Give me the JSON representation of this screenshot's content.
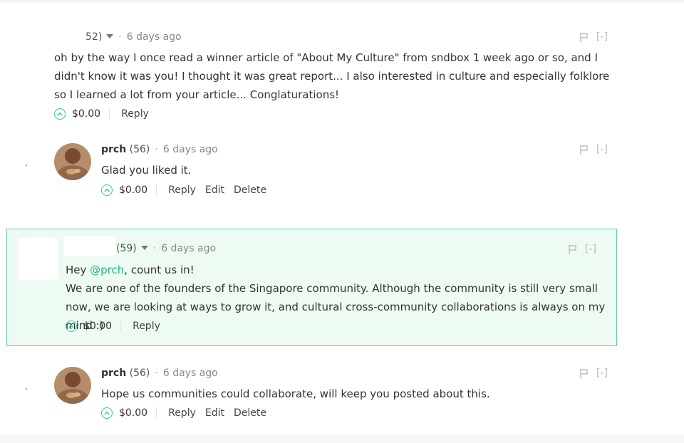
{
  "comments": [
    {
      "author": "",
      "reputation": "52)",
      "time": "6 days ago",
      "text": "oh by the way I once read a winner article of \"About My Culture\" from sndbox 1 week ago or so, and I didn't know it was you! I thought it was great report... I also interested in culture and especially folklore so I learned a lot from your article... Conglaturations!",
      "payout": "$0.00",
      "actions": {
        "reply": "Reply"
      },
      "collapse": "[-]"
    },
    {
      "author": "prch",
      "reputation": "(56)",
      "time": "6 days ago",
      "text": "Glad you liked it.",
      "payout": "$0.00",
      "actions": {
        "reply": "Reply",
        "edit": "Edit",
        "delete": "Delete"
      },
      "collapse": "[-]"
    },
    {
      "author": "",
      "reputation": "(59)",
      "time": "6 days ago",
      "text_prefix": "Hey ",
      "mention": "@prch",
      "text_suffix": ", count us in!",
      "text2": "We are one of the founders of the Singapore community. Although the community is still very small now, we are looking at ways to grow it, and cultural cross-community collaborations is always on my mind :)",
      "payout": "$0.00",
      "actions": {
        "reply": "Reply"
      },
      "collapse": "[-]"
    },
    {
      "author": "prch",
      "reputation": "(56)",
      "time": "6 days ago",
      "text": "Hope us communities could collaborate, will keep you posted about this.",
      "payout": "$0.00",
      "actions": {
        "reply": "Reply",
        "edit": "Edit",
        "delete": "Delete"
      },
      "collapse": "[-]"
    }
  ],
  "colors": {
    "accent": "#35c79c",
    "mention": "#1fb58c",
    "highlight_bg": "#eefbf3",
    "highlight_border": "#5ecfaa"
  },
  "icons": {
    "upvote": "chevron-up-circle-icon",
    "flag": "flag-icon",
    "dropdown": "caret-down-icon"
  },
  "separator": "·"
}
